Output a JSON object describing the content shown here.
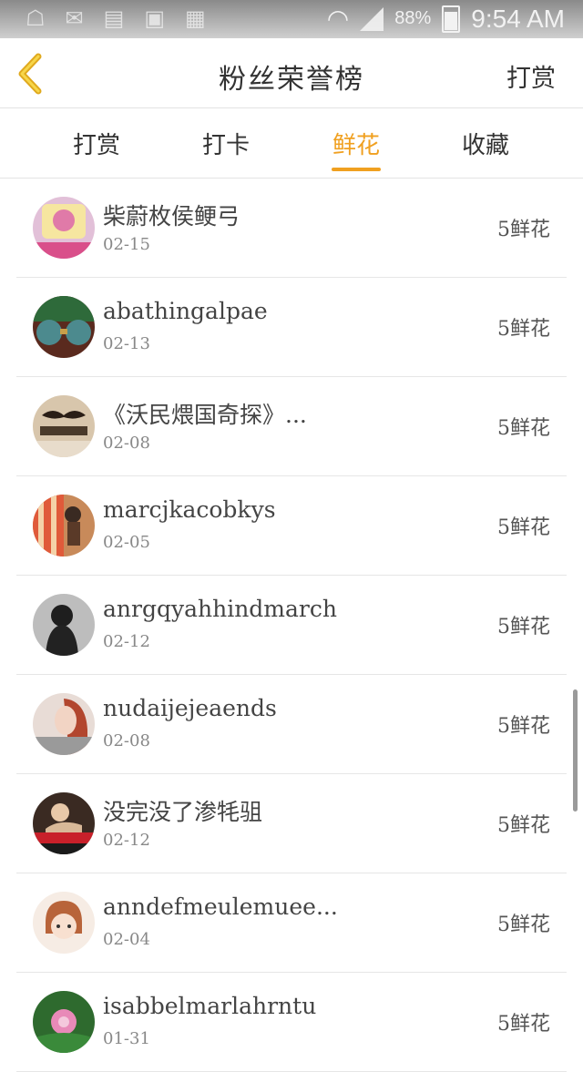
{
  "status_bar": {
    "battery": "88%",
    "time": "9:54 AM"
  },
  "header": {
    "title": "粉丝荣誉榜",
    "right_label": "打赏"
  },
  "tabs": [
    {
      "label": "打赏",
      "active": false
    },
    {
      "label": "打卡",
      "active": false
    },
    {
      "label": "鲜花",
      "active": true
    },
    {
      "label": "收藏",
      "active": false
    }
  ],
  "accent_color": "#f0a020",
  "list": [
    {
      "name": "柴蔚枚侯鲠弓",
      "date": "02-15",
      "amount": "5鲜花"
    },
    {
      "name": "abathingalpae",
      "date": "02-13",
      "amount": "5鲜花"
    },
    {
      "name": "《沃民煨国奇探》...",
      "date": "02-08",
      "amount": "5鲜花"
    },
    {
      "name": "marcjkacobkys",
      "date": "02-05",
      "amount": "5鲜花"
    },
    {
      "name": "anrgqyahhindmarch",
      "date": "02-12",
      "amount": "5鲜花"
    },
    {
      "name": "nudaijejeaends",
      "date": "02-08",
      "amount": "5鲜花"
    },
    {
      "name": "没完没了渗牦驵",
      "date": "02-12",
      "amount": "5鲜花"
    },
    {
      "name": "anndefmeulemuee...",
      "date": "02-04",
      "amount": "5鲜花"
    },
    {
      "name": "isabbelmarlahrntu",
      "date": "01-31",
      "amount": "5鲜花"
    }
  ]
}
